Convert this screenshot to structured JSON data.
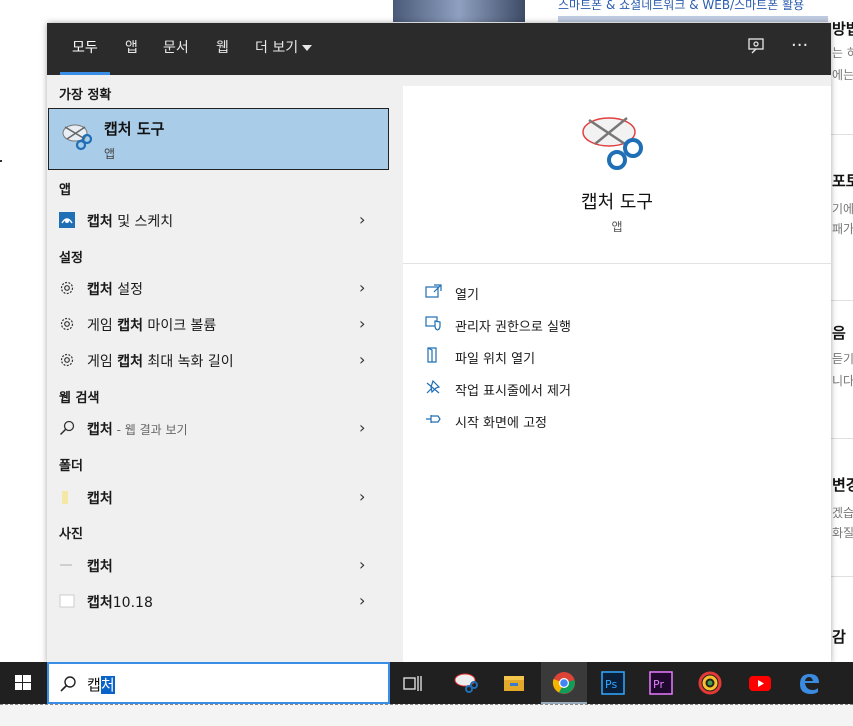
{
  "background_page": {
    "header_link": "스마트폰 & 쇼셜네트워크 & WEB/스마트폰 활용",
    "fragments": [
      {
        "text": "방법",
        "style": "head"
      },
      {
        "text": "는 하",
        "style": "gray"
      },
      {
        "text": "에는",
        "style": "gray"
      },
      {
        "text": "포토",
        "style": "head"
      },
      {
        "text": "기에",
        "style": "gray"
      },
      {
        "text": "패가",
        "style": "gray"
      },
      {
        "text": "음",
        "style": "head"
      },
      {
        "text": "듣기",
        "style": "gray"
      },
      {
        "text": "니다",
        "style": "gray"
      },
      {
        "text": "변경",
        "style": "head"
      },
      {
        "text": "겠습",
        "style": "gray"
      },
      {
        "text": "화질",
        "style": "gray"
      },
      {
        "text": "감",
        "style": "head"
      }
    ]
  },
  "start_menu": {
    "tabs": [
      {
        "label": "모두",
        "active": true
      },
      {
        "label": "앱"
      },
      {
        "label": "문서"
      },
      {
        "label": "웹"
      },
      {
        "label": "더 보기"
      }
    ],
    "feedback_icon": "feedback-icon",
    "more_icon": "···",
    "best_match": {
      "section": "가장 정확",
      "name": "캡처 도구",
      "type": "앱"
    },
    "sections": {
      "apps": "앱",
      "settings": "설정",
      "web": "웹 검색",
      "folders": "폴더",
      "photos": "사진"
    },
    "items": {
      "app1": {
        "bold": "캡처",
        "rest": " 및 스케치"
      },
      "set1": {
        "bold": "캡처",
        "rest": " 설정"
      },
      "set2": {
        "pre": "게임 ",
        "bold": "캡처",
        "rest": " 마이크 볼륨"
      },
      "set3": {
        "pre": "게임 ",
        "bold": "캡처",
        "rest": " 최대 녹화 길이"
      },
      "web1": {
        "bold": "캡처",
        "hint": " - 웹 결과 보기"
      },
      "folder1": {
        "bold": "캡처"
      },
      "photo1": {
        "bold": "캡처"
      },
      "photo2": {
        "bold": "캡처",
        "rest": "10.18"
      }
    },
    "detail": {
      "name": "캡처 도구",
      "type": "앱",
      "actions": [
        {
          "label": "열기",
          "icon": "open-icon"
        },
        {
          "label": "관리자 권한으로 실행",
          "icon": "admin-shield-icon"
        },
        {
          "label": "파일 위치 열기",
          "icon": "file-location-icon"
        },
        {
          "label": "작업 표시줄에서 제거",
          "icon": "unpin-taskbar-icon"
        },
        {
          "label": "시작 화면에 고정",
          "icon": "pin-start-icon"
        }
      ]
    }
  },
  "taskbar": {
    "search_value_plain": "캡",
    "search_value_selected": "처",
    "apps": [
      "task-view",
      "snipping-tool",
      "file-explorer",
      "chrome",
      "photoshop",
      "premiere",
      "app-swirl",
      "youtube",
      "edge"
    ]
  },
  "colors": {
    "accent": "#3a8ee6",
    "best_match_bg": "#a9cce8",
    "menu_bg": "#f0f0f0",
    "topbar_bg": "#2b2b2b",
    "taskbar_bg": "#202020",
    "icon_blue": "#1e6fb5"
  }
}
